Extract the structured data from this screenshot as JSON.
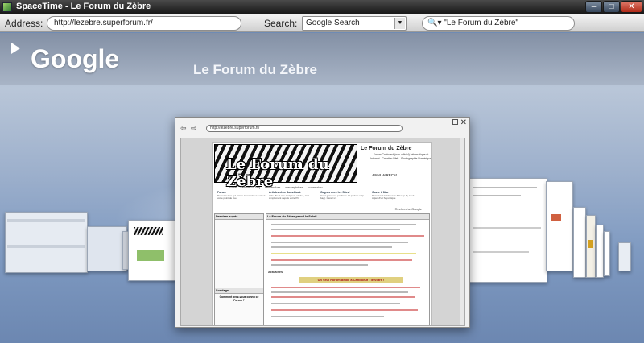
{
  "window": {
    "title": "SpaceTime - Le Forum du Zèbre",
    "minimize": "–",
    "maximize": "□",
    "close": "✕"
  },
  "toolbar": {
    "address_label": "Address:",
    "address_value": "http://lezebre.superforum.fr/",
    "search_label": "Search:",
    "search_engine": "Google Search",
    "search_query": "\"Le Forum du Zèbre\"",
    "search_icon_glyph": "🔍▾"
  },
  "stage": {
    "site_title": "Google",
    "page_subtitle": "Le Forum du Zèbre"
  },
  "preview": {
    "address": "http://lezebre.superforum.fr/",
    "close": "✕",
    "back": "⇦",
    "forward": "⇨",
    "page": {
      "logo_text": "Le Forum du Zèbre",
      "title": "Le Forum du Zèbre",
      "description": "Forum Canboeuf (non-officiel) Informatique et Internet - Création Web - Photographie Numérique",
      "annuaire": "ANNUAIRECat",
      "menu": [
        "portail",
        "forum",
        "faq",
        "rechercher",
        "s'enregistrer",
        "connexion"
      ],
      "columns": [
        {
          "title": "Forum",
          "text": "Découvrez ce qui anime le monde et donnez votre point de vue!"
        },
        {
          "title": "Articles chez Sous-Bock",
          "text": "Aide direct aux analyses, études, tout simplement depuis votre PC"
        },
        {
          "title": "Gagnez avec les Sites!",
          "text": "C'est gérer ses positions. Et (même strip bag). Gérez ici."
        },
        {
          "title": "Ouvre ti Mac",
          "text": "Découvrez le Nouveau Mac up by Luuk Agtereff et Sopxstique"
        }
      ],
      "search_label": "Recherche Google",
      "sidebar_title": "Derniers sujets",
      "main_title": "Le Forum du Zèbre prend le Soleil",
      "news_title": "Actualités",
      "highlight": "Un seul Forum dédié à Canboeuf : le votre !",
      "sondage_title": "Sondage",
      "sondage_question": "Comment avez-vous connu ce Forum ?"
    }
  },
  "colors": {
    "accent": "#6c87b1",
    "titlebar": "#151515"
  }
}
